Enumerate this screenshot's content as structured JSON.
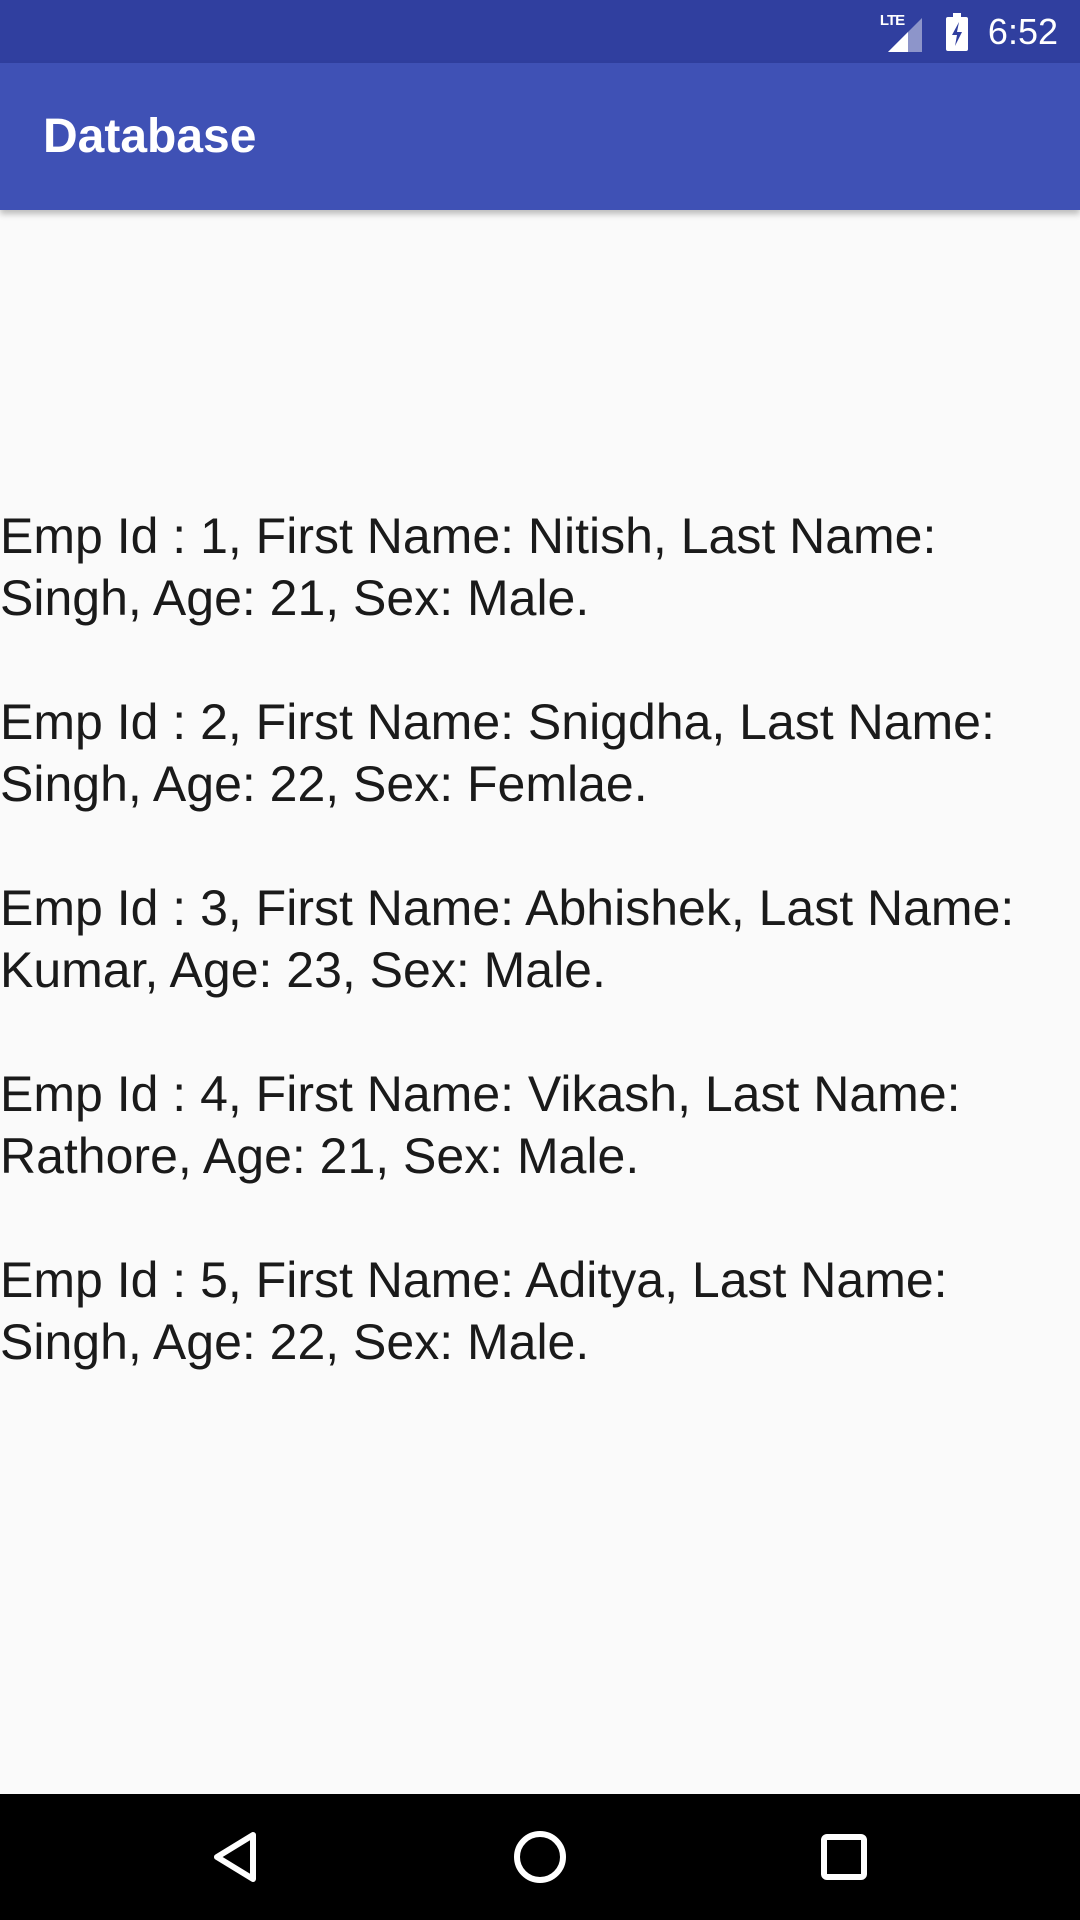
{
  "status_bar": {
    "network_label": "LTE",
    "time": "6:52",
    "icons": [
      "lte-signal-icon",
      "battery-charging-icon"
    ]
  },
  "app_bar": {
    "title": "Database"
  },
  "records": [
    {
      "text": "Emp Id : 1, First Name: Nitish, Last Name:\nSingh, Age: 21, Sex: Male."
    },
    {
      "text": "Emp Id : 2, First Name: Snigdha, Last Name:\nSingh, Age: 22, Sex: Femlae."
    },
    {
      "text": "Emp Id : 3, First Name: Abhishek, Last Name:\nKumar, Age: 23, Sex: Male."
    },
    {
      "text": "Emp Id : 4, First Name: Vikash, Last Name:\nRathore, Age: 21, Sex: Male."
    },
    {
      "text": "Emp Id : 5, First Name: Aditya, Last Name:\nSingh, Age: 22, Sex: Male."
    }
  ],
  "nav_bar": {
    "icons": [
      "back-icon",
      "home-icon",
      "recents-icon"
    ]
  },
  "colors": {
    "status_bar": "#303f9f",
    "app_bar": "#3f51b5",
    "background": "#fafafa",
    "nav_bar": "#000000"
  }
}
